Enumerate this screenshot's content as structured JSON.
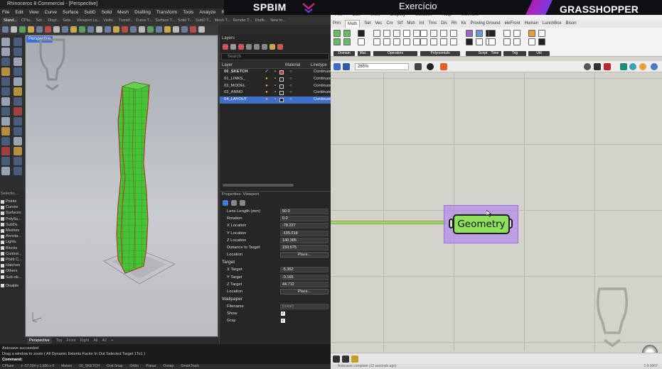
{
  "banner": {
    "brand_left": "SPBIM",
    "title": "Exercício",
    "brand_right": "GRASSHOPPER"
  },
  "rhino": {
    "window_title": "Rhinoceros 8 Commercial - [Perspective]",
    "menu": [
      "File",
      "Edit",
      "View",
      "Curve",
      "Surface",
      "SubD",
      "Solid",
      "Mesh",
      "Drafting",
      "Transform",
      "Tools",
      "Analyze",
      "Render",
      "Window",
      "Help"
    ],
    "toolbar_tabs": [
      "Stand...",
      "CPla...",
      "Set...",
      "Displ...",
      "Sele...",
      "Viewport La...",
      "Visibi...",
      "Transf...",
      "Curve T...",
      "Surface T...",
      "Solid T...",
      "SubD T...",
      "Mesh T...",
      "Render T...",
      "Drafti...",
      "New in..."
    ],
    "viewport_label": "Perspective",
    "viewport_tabs": [
      "Perspective",
      "Top",
      "Front",
      "Right",
      "All",
      "A2",
      "+"
    ],
    "select_panel": {
      "title": "Selectio...",
      "items": [
        "Points",
        "Curves",
        "Surfaces",
        "PolySu...",
        "SubDs",
        "Meshes",
        "Annota...",
        "Lights",
        "Blocks",
        "Control...",
        "Point C...",
        "Hatches",
        "Others",
        "Sub-ob..."
      ],
      "disable_label": "Disable"
    },
    "command": {
      "history": "Autosave succeeded",
      "prompt": "Drag a window to zoom ( All  Dynamic  Extents  Factor  In  Out  Selected  Target  1To1 )",
      "label": "Command:"
    },
    "status_bar": [
      "CPlane",
      "x -57.024  y 1.936  z 0",
      "Meters",
      "00_SKETCH",
      "Grid Snap",
      "Ortho",
      "Planar",
      "Osnap",
      "SmartTrack"
    ]
  },
  "layers": {
    "title": "Layers",
    "search_placeholder": "Search",
    "col_layer": "Layer",
    "col_material": "Material",
    "col_linetype": "Linetype",
    "rows": [
      {
        "name": "00_SKETCH",
        "linetype": "Continuous",
        "current": true,
        "selected": false
      },
      {
        "name": "01_LINKS_",
        "linetype": "Continuous",
        "current": false,
        "selected": false
      },
      {
        "name": "02_MODEL",
        "linetype": "Continuous",
        "current": false,
        "selected": false
      },
      {
        "name": "03_ANNO",
        "linetype": "Continuous",
        "current": false,
        "selected": false
      },
      {
        "name": "04_LAYOUT",
        "linetype": "Continuous",
        "current": false,
        "selected": true
      }
    ]
  },
  "properties": {
    "title": "Properties: Viewport",
    "camera_rows": [
      {
        "label": "Lens Length (mm)",
        "value": "50.0"
      },
      {
        "label": "Rotation",
        "value": "0.0"
      },
      {
        "label": "X Location",
        "value": "-78.227"
      },
      {
        "label": "Y Location",
        "value": "-105.018"
      },
      {
        "label": "Z Location",
        "value": "140.385"
      },
      {
        "label": "Distance to Target",
        "value": "159.675"
      }
    ],
    "location_label": "Location",
    "place_button": "Place...",
    "target_title": "Target",
    "target_rows": [
      {
        "label": "X Target",
        "value": "-5.352"
      },
      {
        "label": "Y Target",
        "value": "-0.165"
      },
      {
        "label": "Z Target",
        "value": "44.712"
      }
    ],
    "wallpaper_title": "Wallpaper",
    "filename_label": "Filename",
    "filename_value": "(none)",
    "show_label": "Show",
    "gray_label": "Gray",
    "show_checked": true,
    "gray_checked": true
  },
  "grasshopper": {
    "menu": [
      "File",
      "Edit",
      "View",
      "Display",
      "Solution",
      "Help",
      "eleFront"
    ],
    "tabs": [
      "Prm",
      "Math",
      "Set",
      "Vec",
      "Crv",
      "Srf",
      "Msh",
      "Int",
      "Trns",
      "Dis",
      "Rh",
      "Kk",
      "Proving Ground",
      "eleFront",
      "Human",
      "LunchBox",
      "Bison"
    ],
    "active_tab": "Math",
    "ribbon_groups": [
      "Domain",
      "Mat...",
      "Operators",
      "Polynomials",
      "Script",
      "Time",
      "Trig",
      "Util"
    ],
    "zoom": "265%",
    "component_label": "Geometry",
    "status_text": "Autosave complete (12 seconds ago)",
    "version": "1.0.0007"
  },
  "colors": {
    "geometry_fill": "#8fe05c",
    "group_fill": "#b58cee",
    "wire": "#a6d46e",
    "layer_selected": "#3f6fc8",
    "tower_green": "#3fbf2f",
    "tower_edges": "#c0392b"
  }
}
